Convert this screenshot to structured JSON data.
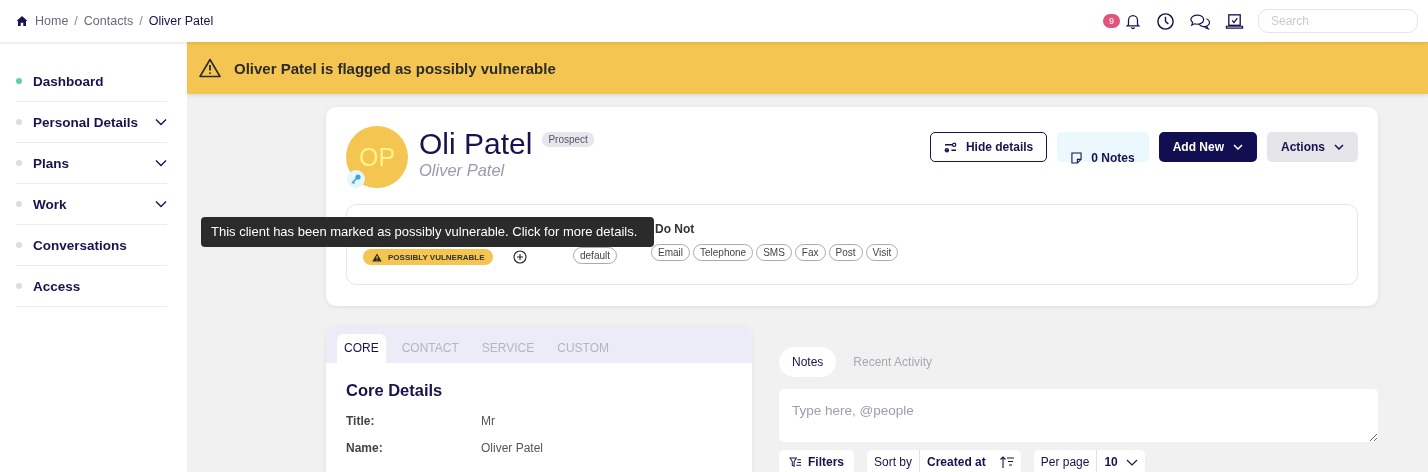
{
  "breadcrumb": [
    {
      "kind": "link",
      "label": "Home",
      "current": false
    },
    {
      "kind": "separator",
      "label": "/"
    },
    {
      "kind": "link",
      "label": "Contacts",
      "current": false
    },
    {
      "kind": "separator",
      "label": "/"
    },
    {
      "kind": "link",
      "label": "Oliver Patel",
      "current": true
    }
  ],
  "topbar": {
    "notification_count": "9",
    "search": {
      "placeholder": "Search"
    }
  },
  "sidebar": {
    "items": [
      {
        "label": "Dashboard",
        "selected": true
      },
      {
        "label": "Personal Details",
        "selected": false,
        "expanded": false
      },
      {
        "label": "Plans",
        "selected": false,
        "expanded": false
      },
      {
        "label": "Work",
        "selected": false,
        "expanded": false
      },
      {
        "label": "Conversations",
        "selected": false
      },
      {
        "label": "Access",
        "selected": false
      }
    ]
  },
  "banner": {
    "text": "Oliver Patel is flagged as possibly vulnerable"
  },
  "profile": {
    "initials": "OP",
    "name": "Oli Patel",
    "status": "Prospect",
    "full_name": "Oliver Patel",
    "buttons": [
      {
        "label": "Hide details",
        "kind": "outline"
      },
      {
        "label": "0 Notes",
        "kind": "notes"
      },
      {
        "label": "Add New",
        "kind": "primary"
      },
      {
        "label": "Actions",
        "kind": "secondary"
      }
    ],
    "vulnerability_badge": "POSSIBLY VULNERABLE",
    "segment": "default",
    "do_not": {
      "heading": "Do Not",
      "channels": [
        "Email",
        "Telephone",
        "SMS",
        "Fax",
        "Post",
        "Visit"
      ]
    },
    "tooltip": "This client has been marked as possibly vulnerable. Click for more details."
  },
  "details": {
    "tabs": [
      {
        "label": "CORE",
        "selected": true
      },
      {
        "label": "CONTACT",
        "selected": false
      },
      {
        "label": "SERVICE",
        "selected": false
      },
      {
        "label": "CUSTOM",
        "selected": false
      }
    ],
    "heading": "Core Details",
    "fields": [
      {
        "label": "Title:",
        "value": "Mr"
      },
      {
        "label": "Name:",
        "value": "Oliver Patel"
      }
    ]
  },
  "notes": {
    "tabs": [
      {
        "label": "Notes",
        "selected": true
      },
      {
        "label": "Recent Activity",
        "selected": false
      }
    ],
    "input": {
      "placeholder": "Type here, @people"
    },
    "filters": "Filters",
    "sort_label": "Sort by",
    "sort_value": "Created at",
    "per_page_label": "Per page",
    "per_page_value": "10"
  }
}
